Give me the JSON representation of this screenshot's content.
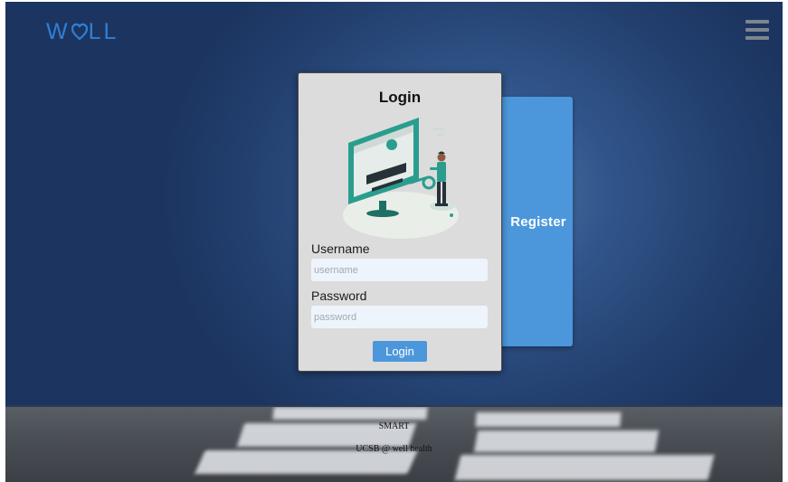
{
  "app": {
    "logo_text": "WELL",
    "logo_left": "W",
    "logo_right": "LL"
  },
  "icons": {
    "menu": "hamburger-menu-icon",
    "logo_mark": "heart-icon",
    "illustration": "login-key-illustration"
  },
  "colors": {
    "accent": "#4c97dc",
    "logo": "#2f7fd6",
    "card": "#dcdcdc",
    "input_bg": "#eef4fc",
    "illustration_teal": "#2a9d8f"
  },
  "login": {
    "title": "Login",
    "username_label": "Username",
    "username_placeholder": "username",
    "username_value": "",
    "password_label": "Password",
    "password_placeholder": "password",
    "password_value": "",
    "submit_label": "Login"
  },
  "register": {
    "label": "Register"
  },
  "footer": {
    "line1": "SMART",
    "line2": "UCSB @ well health"
  }
}
